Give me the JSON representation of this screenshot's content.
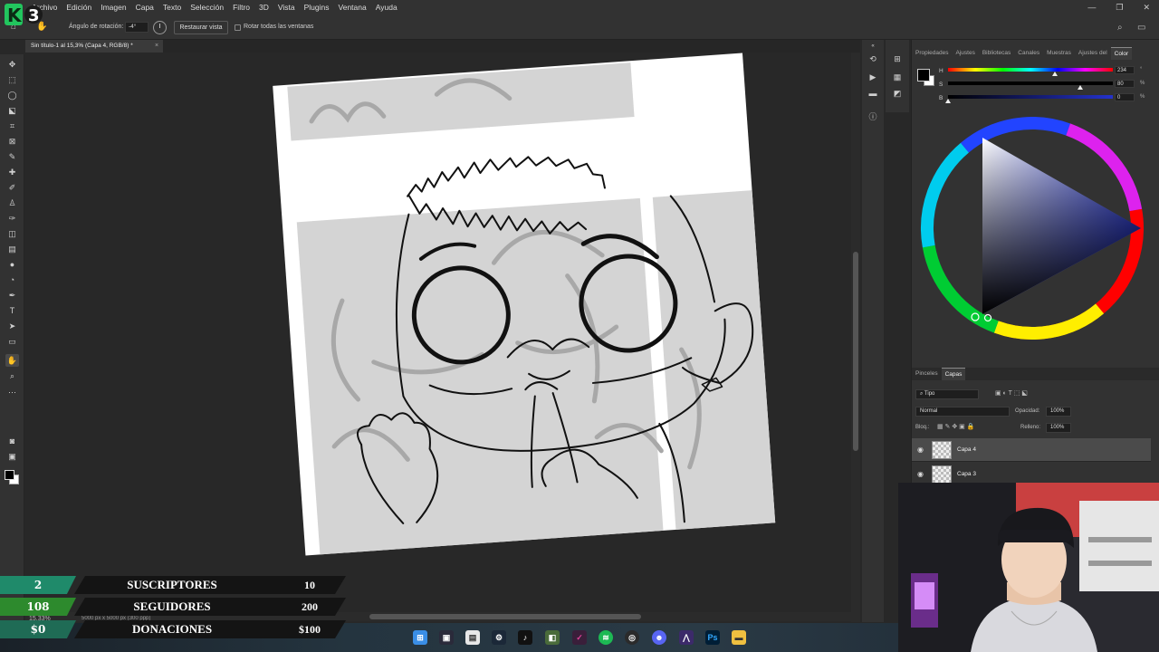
{
  "menu": {
    "items": [
      "Archivo",
      "Edición",
      "Imagen",
      "Capa",
      "Texto",
      "Selección",
      "Filtro",
      "3D",
      "Vista",
      "Plugins",
      "Ventana",
      "Ayuda"
    ]
  },
  "window_controls": {
    "minimize": "—",
    "restore": "❐",
    "close": "✕"
  },
  "options_bar": {
    "rotation_label": "Ángulo de rotación:",
    "rotation_value": "-4°",
    "reset_view_button": "Restaurar vista",
    "rotate_all_label": "Rotar todas las ventanas"
  },
  "document_tab": {
    "title": "Sin título-1 al 15,3% (Capa 4, RGB/8) *",
    "close": "×"
  },
  "status_bar": {
    "zoom": "15,33%",
    "dimensions": "5000 px x 5000 px (300 ppp)"
  },
  "right_panel": {
    "tabs": [
      "Propiedades",
      "Ajustes",
      "Bibliotecas",
      "Canales",
      "Muestras",
      "Ajustes del",
      "Color"
    ],
    "color": {
      "h_label": "H",
      "h_value": "234",
      "h_unit": "°",
      "s_label": "S",
      "s_value": "80",
      "s_unit": "%",
      "b_label": "B",
      "b_value": "0",
      "b_unit": "%",
      "h_fraction": 0.65,
      "s_fraction": 0.8,
      "b_fraction": 0.0
    },
    "layers": {
      "tabs": [
        "Pinceles",
        "Capas"
      ],
      "kind_filter": "Tipo",
      "blend_mode": "Normal",
      "opacity_label": "Opacidad:",
      "opacity_value": "100%",
      "lock_label": "Bloq.:",
      "fill_label": "Relleno:",
      "fill_value": "100%",
      "items": [
        {
          "name": "Capa 4",
          "visible": true,
          "selected": true
        },
        {
          "name": "Capa 3",
          "visible": true,
          "selected": false
        }
      ]
    }
  },
  "overlay": {
    "rows": [
      {
        "left": "2",
        "label": "SUSCRIPTORES",
        "right": "10",
        "color": "#1f8a6a"
      },
      {
        "left": "108",
        "label": "SEGUIDORES",
        "right": "200",
        "color": "#2d8a2d"
      },
      {
        "left": "$0",
        "label": "DONACIONES",
        "right": "$100",
        "color": "#1f6b55"
      }
    ]
  },
  "logo_text": "K3",
  "colors": {
    "accent": "#31a8ff",
    "panel": "#323232",
    "canvas_bg": "#282828"
  }
}
